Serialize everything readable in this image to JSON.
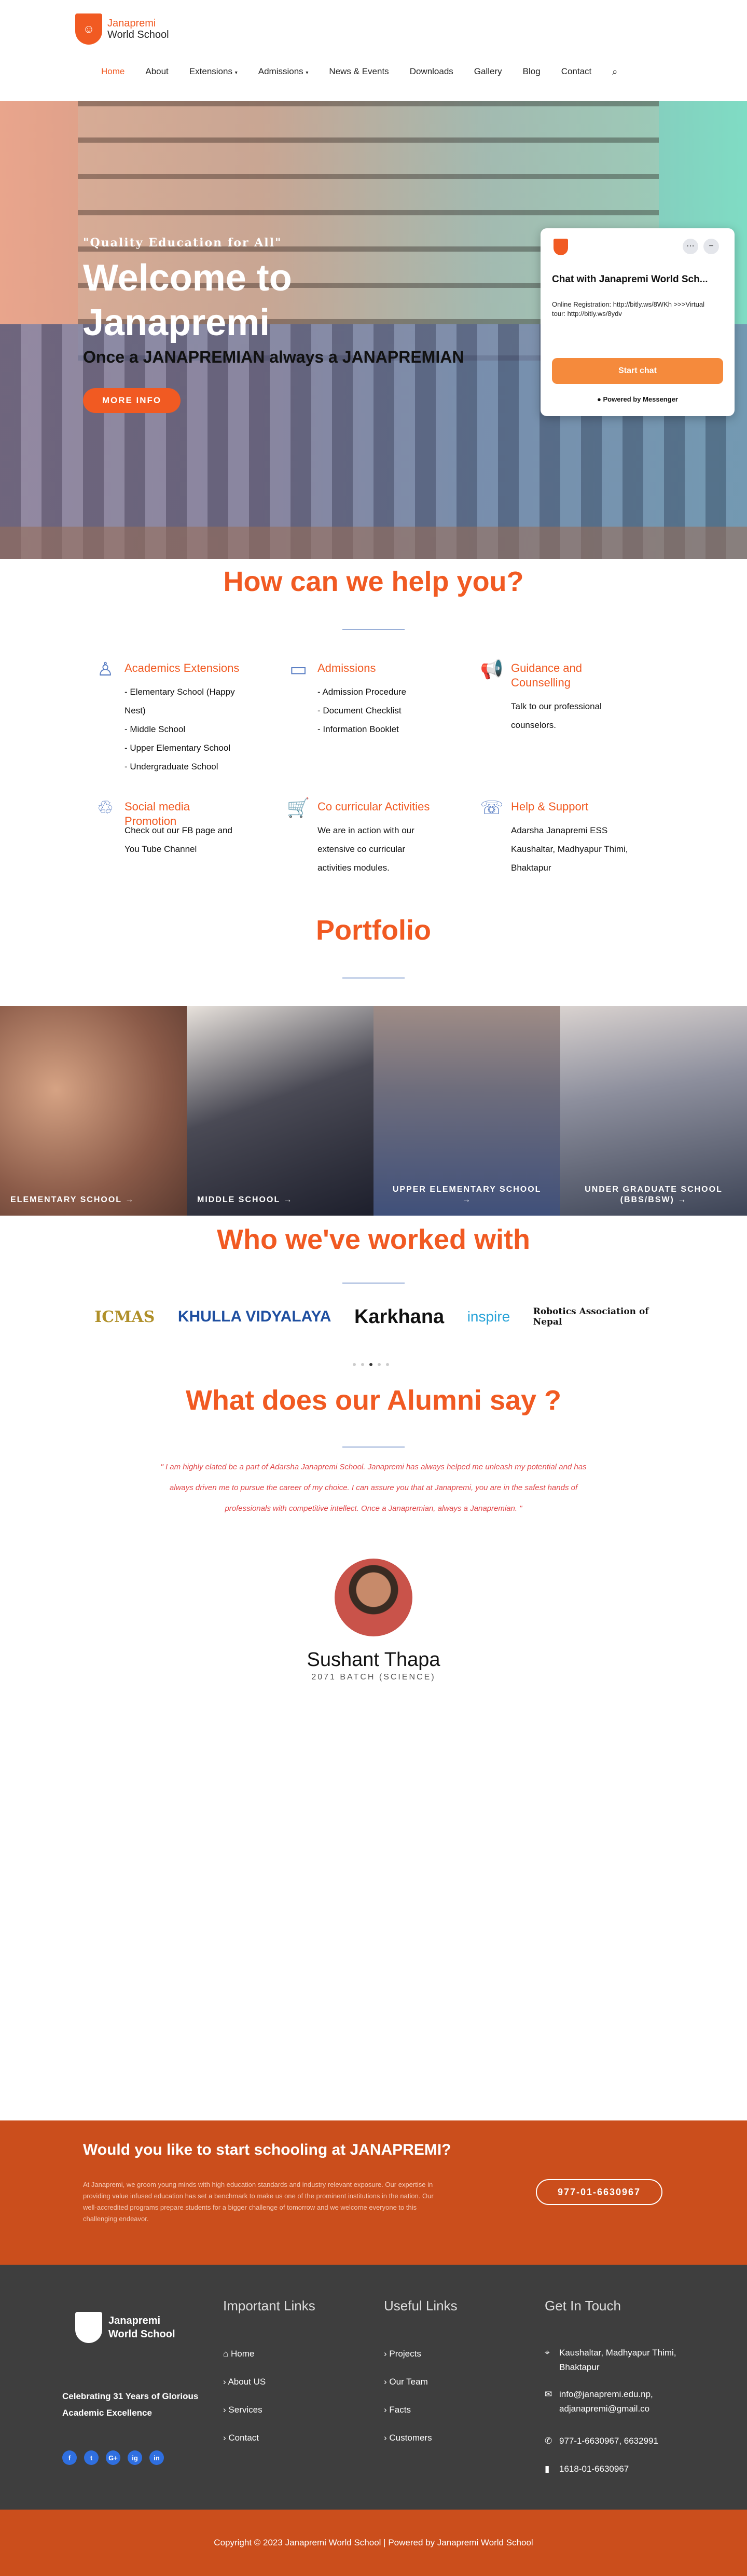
{
  "header": {
    "logo_line1": "Janapremi",
    "logo_line2": "World School",
    "nav": [
      "Home",
      "About",
      "Extensions",
      "Admissions",
      "News & Events",
      "Downloads",
      "Gallery",
      "Blog",
      "Contact"
    ],
    "active_nav": "Home"
  },
  "hero": {
    "quote": "\"Quality Education for All\"",
    "title": "Welcome to Janapremi",
    "tagline": "Once a JANAPREMIAN always a JANAPREMIAN",
    "button": "MORE INFO"
  },
  "chat": {
    "title": "Chat with Janapremi World Sch...",
    "message": "Online Registration: http://bitly.ws/8WKh >>>Virtual tour: http://bitly.ws/8ydv",
    "button": "Start chat",
    "powered": "Powered by Messenger"
  },
  "help": {
    "heading": "How can we help you?",
    "services": [
      {
        "title": "Academics Extensions",
        "desc": "- Elementary School (Happy Nest)\n- Middle School\n- Upper Elementary School\n- Undergraduate School",
        "icon": "academics-icon"
      },
      {
        "title": "Admissions",
        "desc": "- Admission Procedure\n- Document Checklist\n- Information Booklet",
        "icon": "admissions-icon"
      },
      {
        "title": "Guidance and Counselling",
        "desc": "Talk to our professional counselors.",
        "icon": "megaphone-icon"
      },
      {
        "title": "Social media Promotion",
        "desc": "Check out our FB page and You Tube Channel",
        "icon": "social-icon"
      },
      {
        "title": "Co curricular Activities",
        "desc": "We are in action with our extensive co curricular activities modules.",
        "icon": "cart-icon"
      },
      {
        "title": "Help & Support",
        "desc": "Adarsha  Janapremi ESS Kaushaltar, Madhyapur Thimi, Bhaktapur",
        "icon": "support-icon"
      }
    ]
  },
  "portfolio": {
    "heading": "Portfolio",
    "tiles": [
      "ELEMENTARY SCHOOL",
      "MIDDLE SCHOOL",
      "UPPER ELEMENTARY SCHOOL",
      "UNDER GRADUATE SCHOOL (BBS/BSW)"
    ]
  },
  "partners": {
    "heading": "Who we've worked with",
    "logos": [
      "ICMAS",
      "KHULLA VIDYALAYA",
      "Karkhana",
      "inspire",
      "Robotics Association of Nepal"
    ]
  },
  "alumni": {
    "heading": "What does our Alumni say ?",
    "quote": "\" I am highly elated be a part of Adarsha Janapremi School. Janapremi has always helped me unleash my potential and has always driven me to pursue the career of my choice. I can assure you that at Janapremi, you are in the safest hands of professionals with competitive intellect. Once a Janapremian, always a Janapremian. \"",
    "name": "Sushant Thapa",
    "batch": "2071 BATCH (SCIENCE)"
  },
  "cta": {
    "heading": "Would you like to start schooling at JANAPREMI?",
    "text": "At Janapremi, we groom young minds with high education standards and industry relevant exposure. Our expertise in providing value infused education has set a benchmark to make us one of the prominent institutions in the nation. Our well-accredited programs prepare students for a bigger challenge of tomorrow and we welcome everyone to this challenging endeavor.",
    "phone": "977-01-6630967"
  },
  "footer": {
    "logo_line1": "Janapremi",
    "logo_line2": "World School",
    "celebrating": "Celebrating 31 Years of Glorious Academic Excellence",
    "important_heading": "Important Links",
    "important_links": [
      "Home",
      "About US",
      "Services",
      "Contact"
    ],
    "useful_heading": "Useful Links",
    "useful_links": [
      "Projects",
      "Our Team",
      "Facts",
      "Customers"
    ],
    "contact_heading": "Get In Touch",
    "address": "Kaushaltar, Madhyapur Thimi, Bhaktapur",
    "email": "info@janapremi.edu.np, adjanapremi@gmail.co",
    "phone": "977-1-6630967, 6632991",
    "fax": "1618-01-6630967",
    "social": [
      "f",
      "t",
      "G+",
      "ig",
      "in"
    ]
  },
  "copyright": "Copyright © 2023 Janapremi World School | Powered by Janapremi World School",
  "colors": {
    "accent": "#f15a22",
    "cta_bg": "#cb4e1c",
    "footer_bg": "#3e3e3e",
    "rule": "#9ab0d8"
  }
}
